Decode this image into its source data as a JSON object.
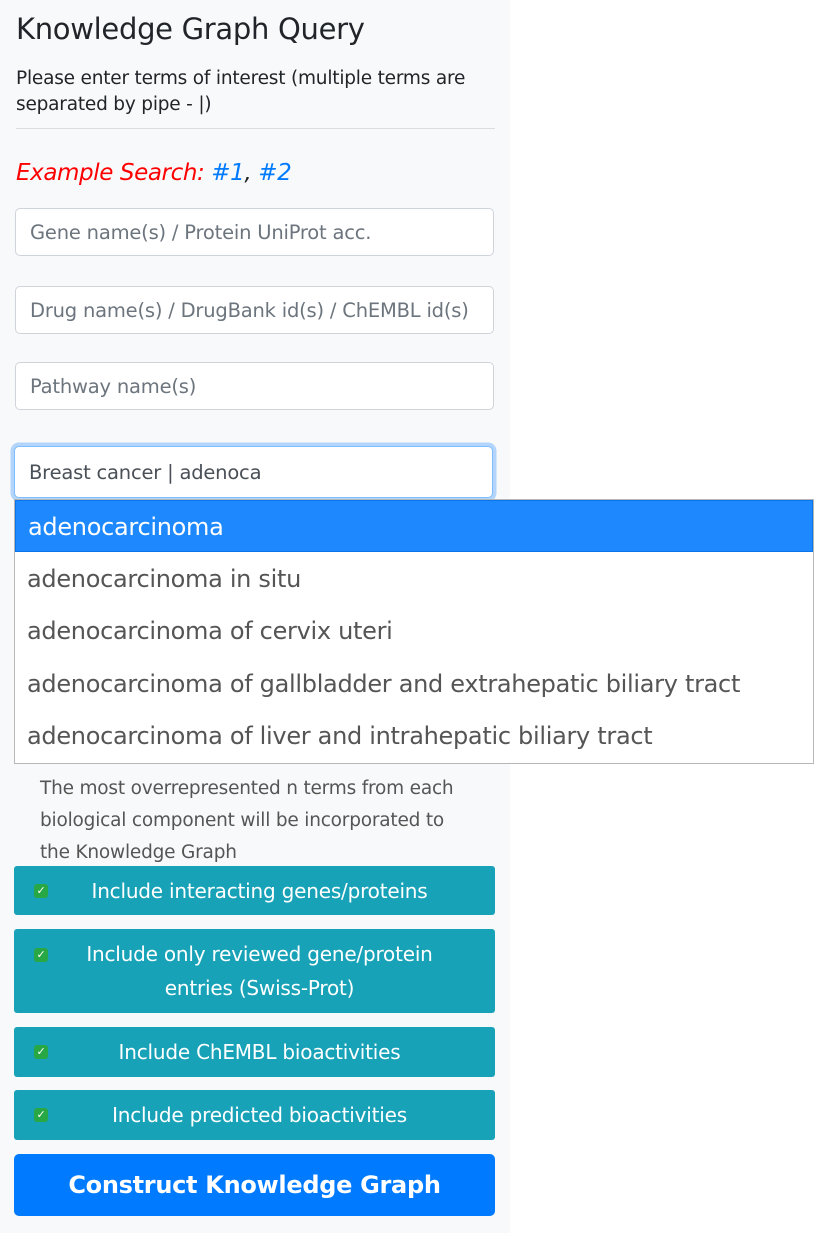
{
  "header": {
    "title": "Knowledge Graph Query",
    "instructions": "Please enter terms of interest (multiple terms are separated by pipe - |)"
  },
  "example": {
    "label": "Example Search:",
    "link1": "#1",
    "separator": ",",
    "link2": "#2"
  },
  "inputs": {
    "gene": {
      "placeholder": "Gene name(s) / Protein UniProt acc.",
      "value": ""
    },
    "drug": {
      "placeholder": "Drug name(s) / DrugBank id(s) / ChEMBL id(s)",
      "value": ""
    },
    "pathway": {
      "placeholder": "Pathway name(s)",
      "value": ""
    },
    "disease": {
      "placeholder": "",
      "value": "Breast cancer | adenoca"
    }
  },
  "autocomplete": {
    "items": [
      "adenocarcinoma",
      "adenocarcinoma in situ",
      "adenocarcinoma of cervix uteri",
      "adenocarcinoma of gallbladder and extrahepatic biliary tract",
      "adenocarcinoma of liver and intrahepatic biliary tract"
    ],
    "active_index": 0
  },
  "note": "The most overrepresented n terms from each biological component will be incorporated to the Knowledge Graph",
  "toggles": [
    {
      "label": "Include interacting genes/proteins",
      "checked": true
    },
    {
      "label": "Include only reviewed gene/protein entries (Swiss-Prot)",
      "checked": true
    },
    {
      "label": "Include ChEMBL bioactivities",
      "checked": true
    },
    {
      "label": "Include predicted bioactivities",
      "checked": true
    }
  ],
  "construct_label": "Construct Knowledge Graph",
  "colors": {
    "primary": "#007bff",
    "toggle": "#17a2b8",
    "example_label": "#ff0000",
    "checkbox": "#28a745",
    "dropdown_active": "#1e88ff"
  },
  "icons": {
    "checkbox": "check-icon"
  }
}
